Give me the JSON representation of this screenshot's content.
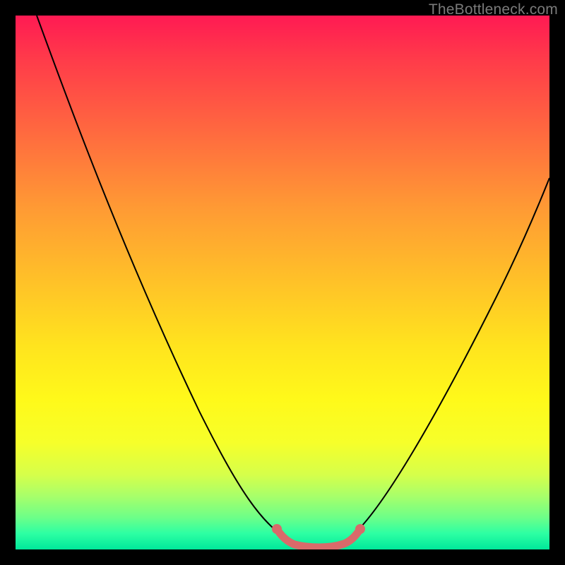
{
  "watermark": "TheBottleneck.com",
  "chart_data": {
    "type": "line",
    "title": "",
    "xlabel": "",
    "ylabel": "",
    "xlim": [
      0,
      100
    ],
    "ylim": [
      0,
      100
    ],
    "grid": false,
    "legend": false,
    "series": [
      {
        "name": "bottleneck-curve",
        "color": "#000000",
        "x": [
          0,
          5,
          10,
          15,
          20,
          25,
          30,
          35,
          40,
          45,
          50,
          53,
          55,
          57,
          60,
          62,
          65,
          70,
          75,
          80,
          85,
          90,
          95,
          100
        ],
        "y": [
          100,
          90,
          80,
          70,
          60,
          50,
          41,
          32,
          24,
          16,
          8,
          3,
          1,
          0.5,
          0.5,
          1,
          4,
          11,
          20,
          29,
          38,
          46,
          54,
          62
        ]
      },
      {
        "name": "optimal-zone-highlight",
        "color": "#d96a6a",
        "x": [
          50,
          52,
          54,
          56,
          58,
          60,
          62,
          64
        ],
        "y": [
          4,
          2.2,
          1.1,
          0.7,
          0.7,
          1.0,
          2.0,
          4.0
        ]
      }
    ],
    "background_gradient": {
      "orientation": "vertical",
      "stops": [
        {
          "pos": 0.0,
          "color": "#ff1a53"
        },
        {
          "pos": 0.5,
          "color": "#ffc228"
        },
        {
          "pos": 0.8,
          "color": "#f6ff2a"
        },
        {
          "pos": 1.0,
          "color": "#00e89a"
        }
      ]
    }
  }
}
